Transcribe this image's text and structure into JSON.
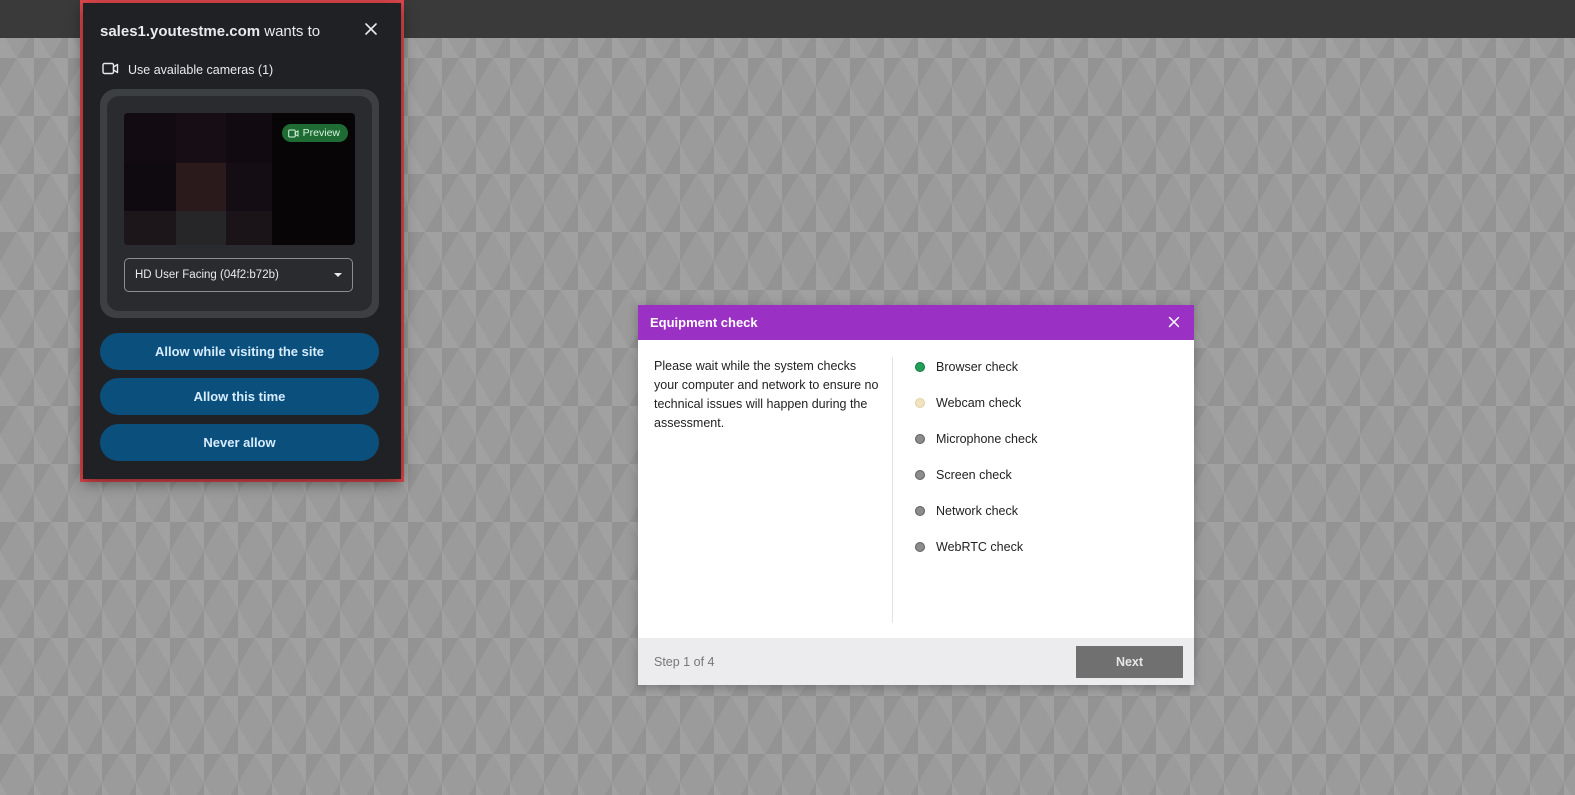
{
  "permission_prompt": {
    "origin": "sales1.youtestme.com",
    "title_suffix": " wants to",
    "request_label": "Use available cameras (1)",
    "preview_badge": "Preview",
    "camera_selected": "HD User Facing (04f2:b72b)",
    "buttons": {
      "allow_while_visiting": "Allow while visiting the site",
      "allow_this_time": "Allow this time",
      "never_allow": "Never allow"
    }
  },
  "equipment_check": {
    "title": "Equipment check",
    "description": "Please wait while the system checks your computer and network to ensure no technical issues will happen during the assessment.",
    "checks": [
      {
        "label": "Browser check",
        "status": "passed"
      },
      {
        "label": "Webcam check",
        "status": "in-progress"
      },
      {
        "label": "Microphone check",
        "status": "pending"
      },
      {
        "label": "Screen check",
        "status": "pending"
      },
      {
        "label": "Network check",
        "status": "pending"
      },
      {
        "label": "WebRTC check",
        "status": "pending"
      }
    ],
    "step_label": "Step 1 of 4",
    "next_label": "Next"
  },
  "colors": {
    "dialog_header": "#9b30c4",
    "permission_button": "#0b4f7c",
    "status_passed": "#22a05a",
    "status_in_progress": "#f2e3c2",
    "status_pending": "#8c8c8c",
    "highlight_border": "#e0474c"
  }
}
